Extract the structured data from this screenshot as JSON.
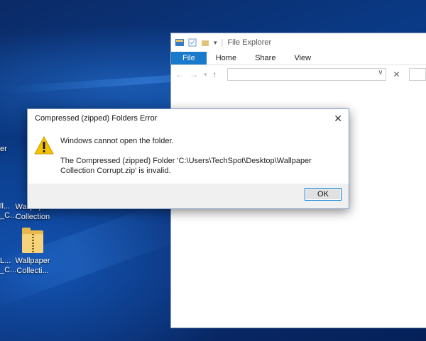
{
  "desktop": {
    "fragments": [
      "er",
      "ll...",
      "_C...",
      "L...",
      "_C..."
    ],
    "icons": [
      {
        "label": "Wallpaper Collection"
      },
      {
        "label": "Wallpaper Collecti..."
      }
    ]
  },
  "explorer": {
    "title": "File Explorer",
    "ribbon_tabs": [
      "File",
      "Home",
      "Share",
      "View"
    ],
    "address": "",
    "nav": {
      "back": "←",
      "forward": "→",
      "recent": "▾",
      "up": "↑"
    }
  },
  "dialog": {
    "title": "Compressed (zipped) Folders Error",
    "message": "Windows cannot open the folder.",
    "detail": "The Compressed (zipped) Folder 'C:\\Users\\TechSpot\\Desktop\\Wallpaper Collection Corrupt.zip' is invalid.",
    "ok_label": "OK",
    "close_glyph": "✕"
  },
  "colors": {
    "accent": "#1979ca",
    "warning": "#f5c400",
    "desktop": "#0a3a86"
  }
}
